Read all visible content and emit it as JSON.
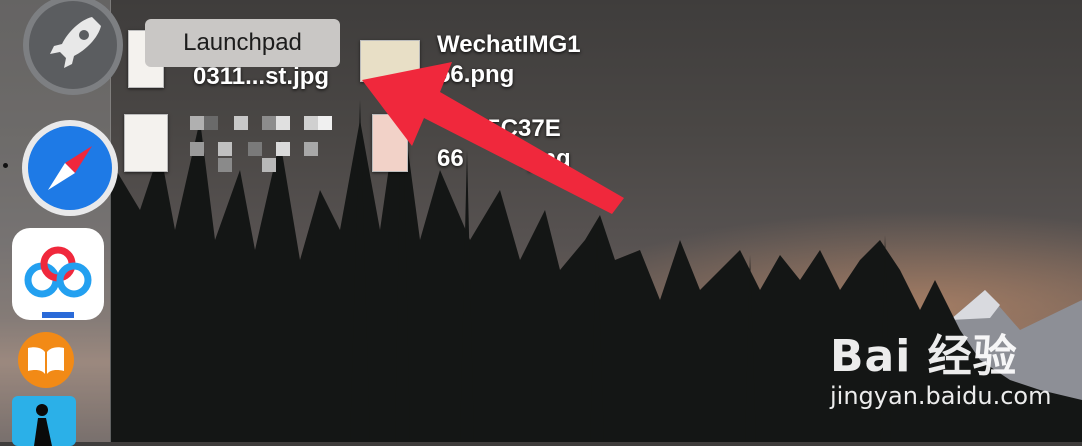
{
  "tooltip": {
    "label": "Launchpad"
  },
  "desktop": {
    "files": [
      {
        "line1": "0311...st.jpg",
        "line2": ""
      },
      {
        "line1": "WechatIMG1",
        "line2": "56.png"
      },
      {
        "line1": "C5C37E",
        "line2": "66",
        "line3": ".png"
      }
    ]
  },
  "dock": {
    "icons": [
      "launchpad-icon",
      "safari-icon",
      "baidu-netdisk-icon",
      "ibooks-icon",
      "kindle-icon"
    ]
  },
  "watermark": {
    "brand": "Bai  经验",
    "url": "jingyan.baidu.com"
  },
  "colors": {
    "arrow": "#f0283c",
    "tooltip_bg": "#c9c7c5",
    "safari_blue": "#1e7ae6"
  }
}
